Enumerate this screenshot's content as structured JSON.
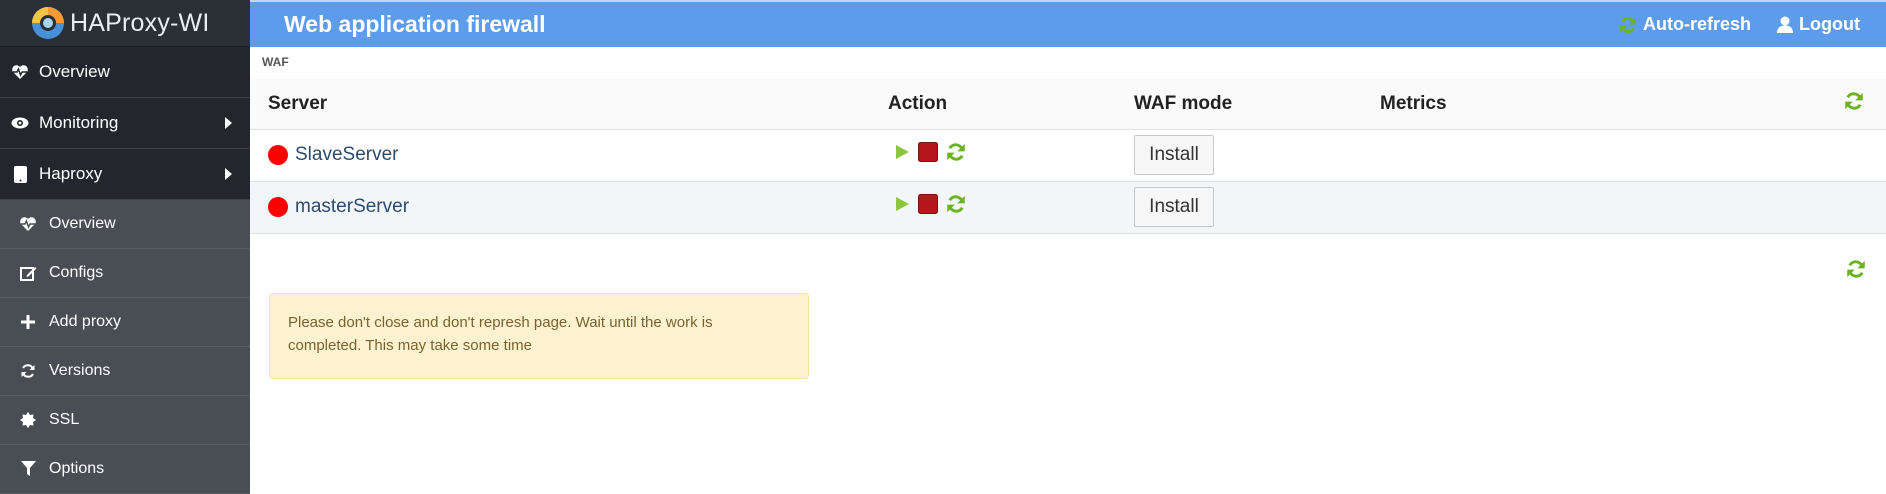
{
  "app": {
    "name": "HAProxy-WI"
  },
  "sidebar": {
    "top_items": [
      {
        "label": "Overview",
        "icon": "heartbeat-icon"
      },
      {
        "label": "Monitoring",
        "icon": "eye-icon"
      },
      {
        "label": "Haproxy",
        "icon": "tablet-icon"
      }
    ],
    "sub_items": [
      {
        "label": "Overview",
        "icon": "heartbeat-icon"
      },
      {
        "label": "Configs",
        "icon": "edit-icon"
      },
      {
        "label": "Add proxy",
        "icon": "plus-icon"
      },
      {
        "label": "Versions",
        "icon": "sync-icon"
      },
      {
        "label": "SSL",
        "icon": "certificate-icon"
      },
      {
        "label": "Options",
        "icon": "filter-icon"
      }
    ]
  },
  "header": {
    "title": "Web application firewall",
    "auto_refresh": "Auto-refresh",
    "logout": "Logout"
  },
  "breadcrumb": "WAF",
  "table": {
    "columns": {
      "server": "Server",
      "action": "Action",
      "waf_mode": "WAF mode",
      "metrics": "Metrics"
    },
    "rows": [
      {
        "name": "SlaveServer",
        "status": "down",
        "button": "Install"
      },
      {
        "name": "masterServer",
        "status": "down",
        "button": "Install"
      }
    ]
  },
  "alert": {
    "text": "Please don't close and don't represh page. Wait until the work is completed. This may take some time"
  },
  "colors": {
    "header": "#5d9ceb",
    "sidebar": "#292d33",
    "status_down": "#ff0000",
    "refresh_green": "#6bb320"
  }
}
